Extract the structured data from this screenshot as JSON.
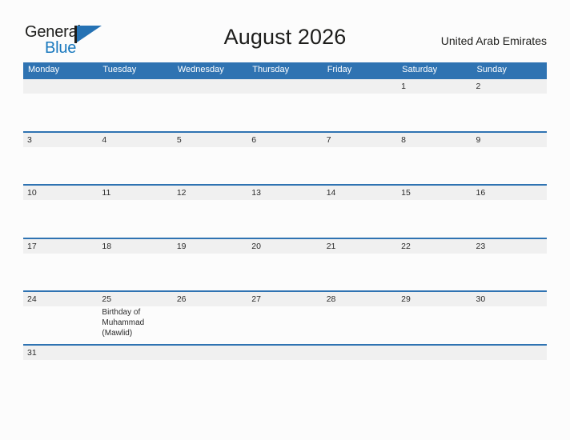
{
  "brand": {
    "name_line1": "General",
    "name_line2": "Blue",
    "flag_icon": "flag-icon",
    "accent_color": "#1878be",
    "flag_color": "#2572b4"
  },
  "header": {
    "title": "August 2026",
    "country": "United Arab Emirates"
  },
  "calendar": {
    "header_color": "#2f73b2",
    "band_color": "#f0f0f0",
    "weekdays": [
      "Monday",
      "Tuesday",
      "Wednesday",
      "Thursday",
      "Friday",
      "Saturday",
      "Sunday"
    ],
    "weeks": [
      [
        {
          "day": ""
        },
        {
          "day": ""
        },
        {
          "day": ""
        },
        {
          "day": ""
        },
        {
          "day": ""
        },
        {
          "day": "1"
        },
        {
          "day": "2"
        }
      ],
      [
        {
          "day": "3"
        },
        {
          "day": "4"
        },
        {
          "day": "5"
        },
        {
          "day": "6"
        },
        {
          "day": "7"
        },
        {
          "day": "8"
        },
        {
          "day": "9"
        }
      ],
      [
        {
          "day": "10"
        },
        {
          "day": "11"
        },
        {
          "day": "12"
        },
        {
          "day": "13"
        },
        {
          "day": "14"
        },
        {
          "day": "15"
        },
        {
          "day": "16"
        }
      ],
      [
        {
          "day": "17"
        },
        {
          "day": "18"
        },
        {
          "day": "19"
        },
        {
          "day": "20"
        },
        {
          "day": "21"
        },
        {
          "day": "22"
        },
        {
          "day": "23"
        }
      ],
      [
        {
          "day": "24"
        },
        {
          "day": "25",
          "event": "Birthday of Muhammad (Mawlid)"
        },
        {
          "day": "26"
        },
        {
          "day": "27"
        },
        {
          "day": "28"
        },
        {
          "day": "29"
        },
        {
          "day": "30"
        }
      ],
      [
        {
          "day": "31"
        },
        {
          "day": ""
        },
        {
          "day": ""
        },
        {
          "day": ""
        },
        {
          "day": ""
        },
        {
          "day": ""
        },
        {
          "day": ""
        }
      ]
    ]
  }
}
